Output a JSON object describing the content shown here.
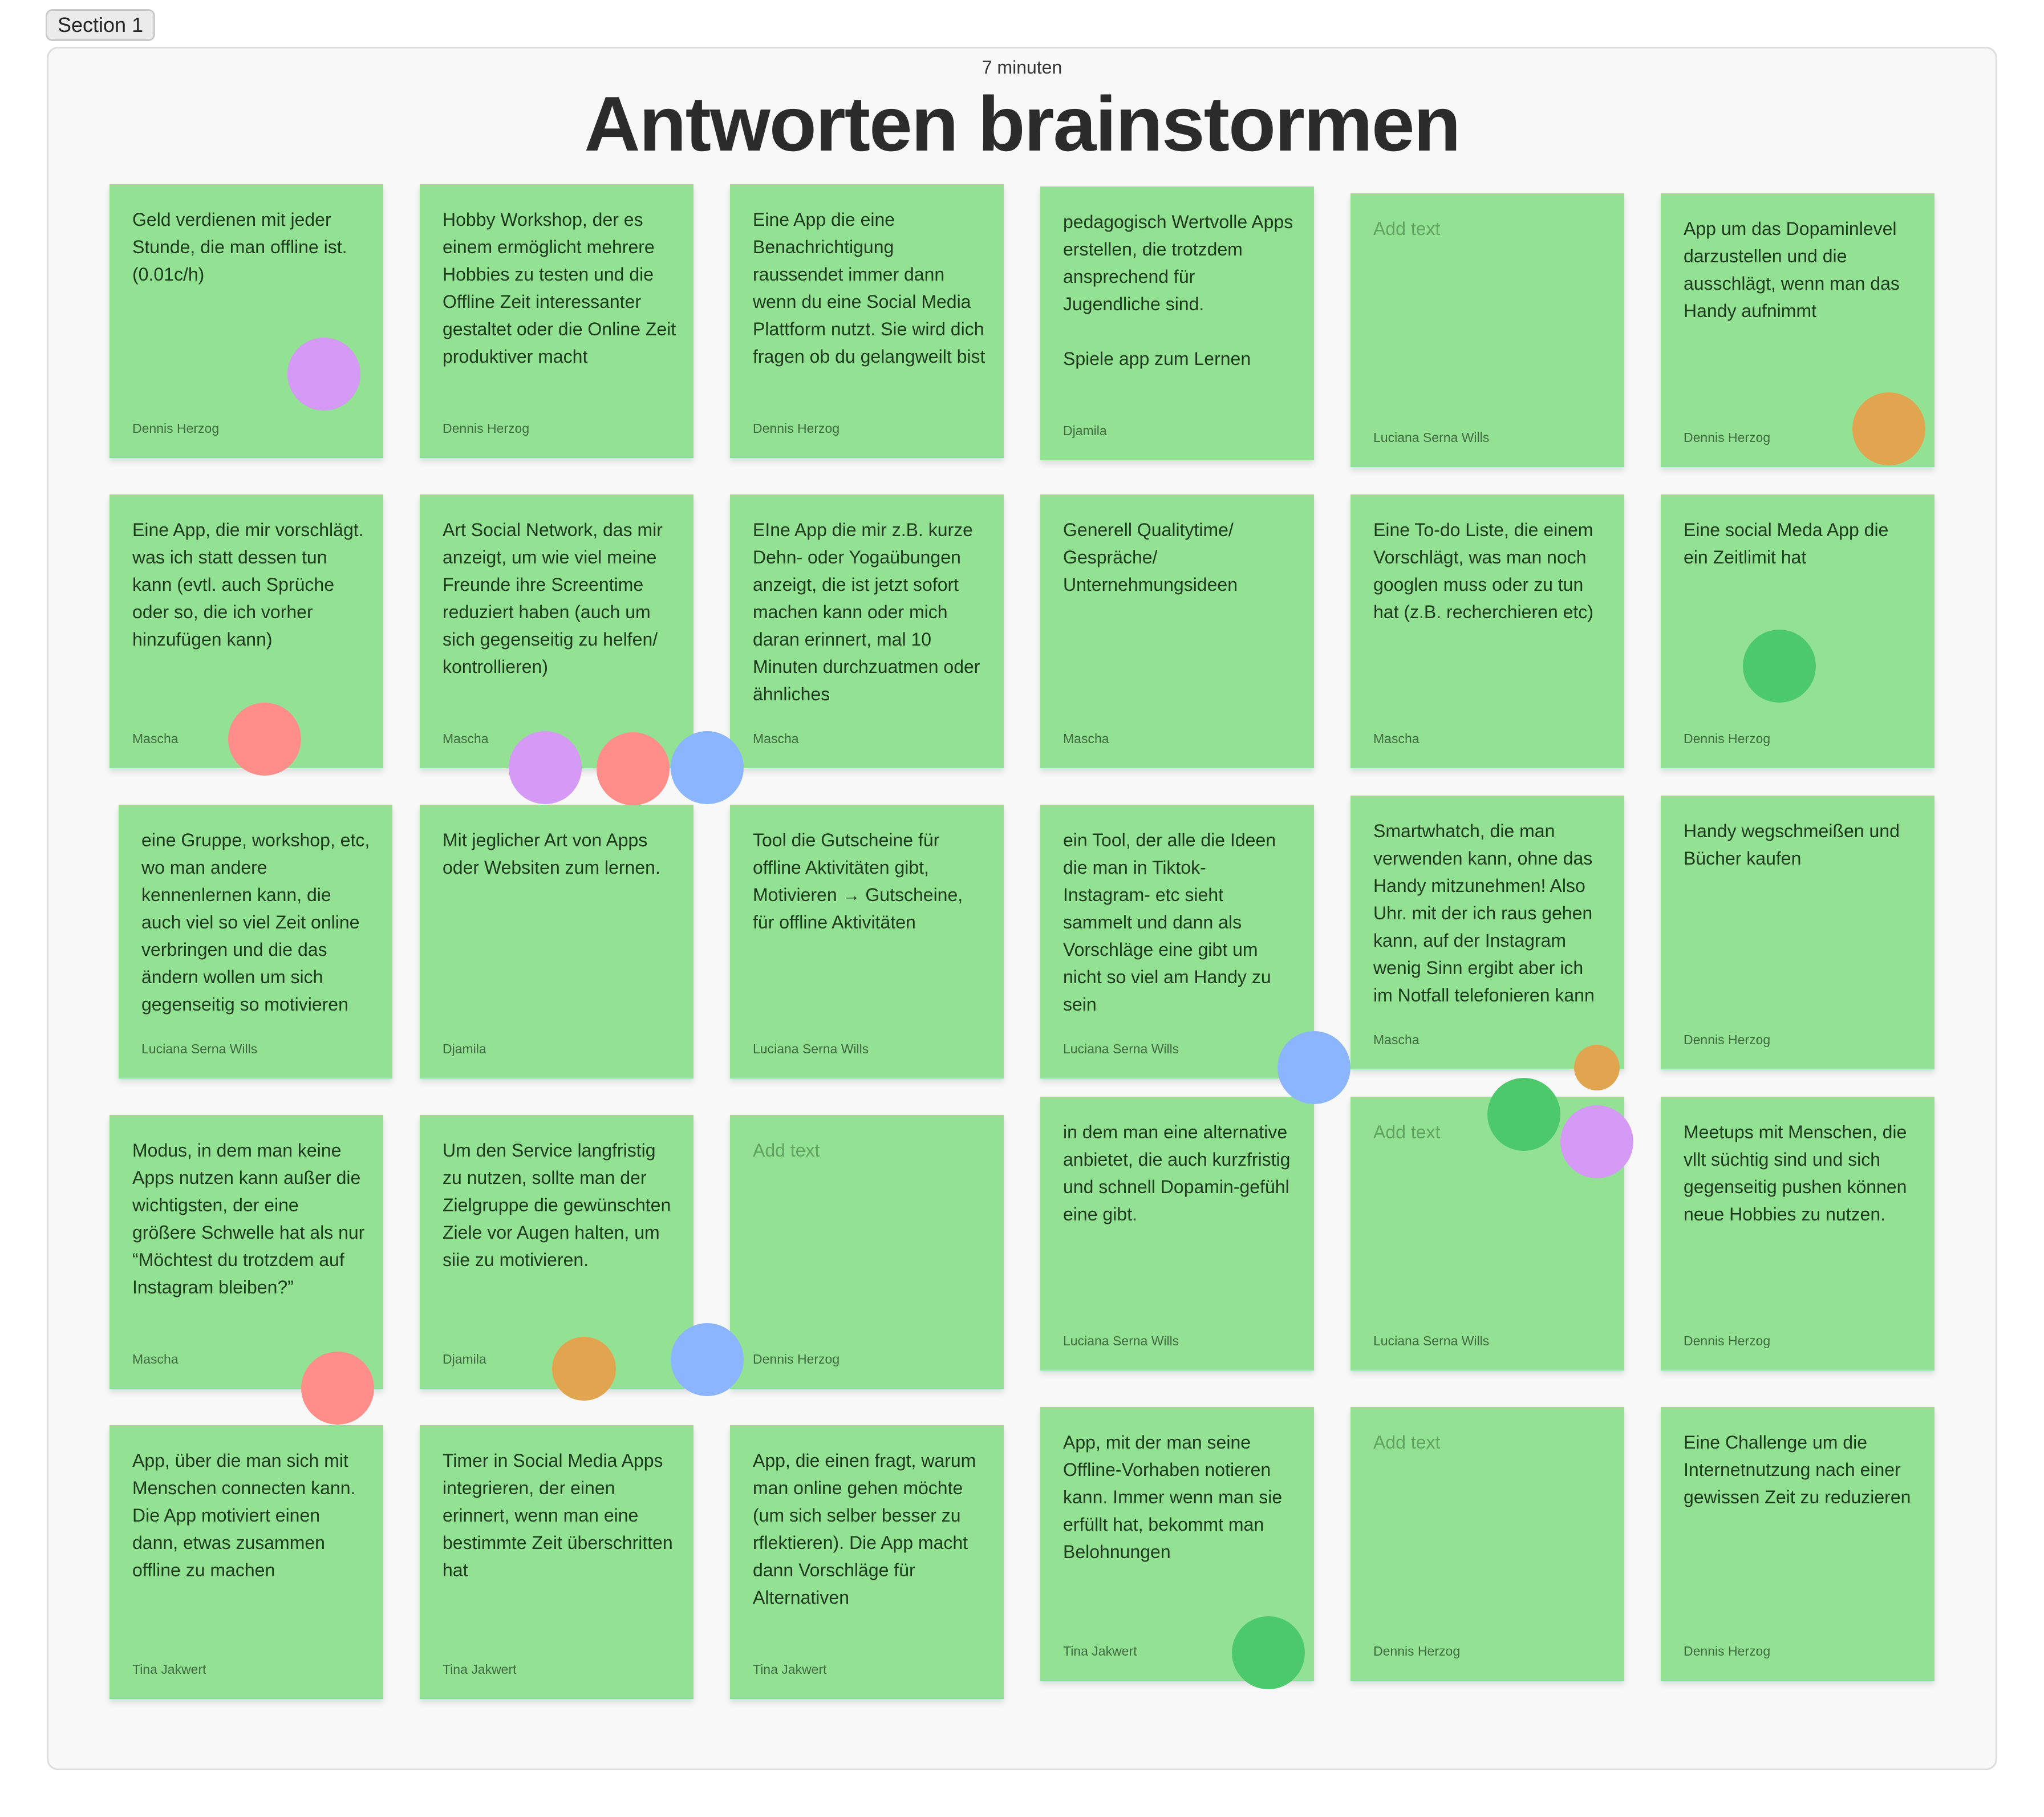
{
  "section": {
    "label": "Section 1"
  },
  "header": {
    "subtitle": "7 minuten",
    "title": "Antworten brainstormen"
  },
  "colors": {
    "sticky": "#93e293",
    "dot_purple": "#d49af5",
    "dot_orange": "#e2a54f",
    "dot_red": "#ff8e8a",
    "dot_blue": "#8bb6ff",
    "dot_green": "#4cc96b"
  },
  "notes": [
    {
      "text": "Geld verdienen mit jeder Stunde, die man offline ist. (0.01c/h)",
      "author": "Dennis Herzog"
    },
    {
      "text": "Hobby Workshop, der es einem ermöglicht mehrere Hobbies zu testen und die Offline Zeit interessanter gestaltet oder die Online Zeit produktiver macht",
      "author": "Dennis Herzog"
    },
    {
      "text": "Eine App die eine Benachrichtigung raussendet immer dann wenn du eine Social Media Plattform nutzt. Sie wird dich fragen ob du gelangweilt bist",
      "author": "Dennis Herzog"
    },
    {
      "text": "pedagogisch Wertvolle Apps erstellen, die trotzdem ansprechend für Jugendliche sind.\n\nSpiele app zum Lernen",
      "author": "Djamila"
    },
    {
      "text": "Add text",
      "author": "Luciana Serna Wills"
    },
    {
      "text": "App um das Dopaminlevel darzustellen und die ausschlägt, wenn man das Handy aufnimmt",
      "author": "Dennis Herzog"
    },
    {
      "text": "Eine App, die mir vorschlägt. was ich statt dessen tun kann (evtl. auch Sprüche oder so, die ich vorher hinzufügen kann)",
      "author": "Mascha"
    },
    {
      "text": "Art Social Network, das mir anzeigt, um wie viel meine Freunde ihre Screentime reduziert haben (auch um sich gegenseitig zu helfen/ kontrollieren)",
      "author": "Mascha"
    },
    {
      "text": "EIne App die mir z.B. kurze Dehn- oder Yogaübungen anzeigt, die ist jetzt sofort machen kann oder mich daran erinnert, mal 10 Minuten durchzuatmen oder ähnliches",
      "author": "Mascha"
    },
    {
      "text": "Generell Qualitytime/ Gespräche/ Unternehmungsideen",
      "author": "Mascha"
    },
    {
      "text": "Eine To-do Liste, die einem Vorschlägt, was man noch googlen muss oder zu tun hat (z.B. recherchieren etc)",
      "author": "Mascha"
    },
    {
      "text": "Eine social Meda App die ein Zeitlimit hat",
      "author": "Dennis Herzog"
    },
    {
      "text": "eine Gruppe, workshop, etc, wo man andere kennenlernen kann, die auch viel so viel Zeit online verbringen und die das ändern wollen um sich gegenseitig so motivieren",
      "author": "Luciana Serna Wills"
    },
    {
      "text": "Mit jeglicher Art von Apps oder Websiten zum lernen.",
      "author": "Djamila"
    },
    {
      "text": "Tool die Gutscheine für offline Aktivitäten gibt, Motivieren → Gutscheine, für offline Aktivitäten",
      "author": "Luciana Serna Wills"
    },
    {
      "text": "ein Tool, der alle die Ideen die man in Tiktok- Instagram- etc sieht sammelt und dann als Vorschläge eine gibt um nicht so viel am Handy zu sein",
      "author": "Luciana Serna Wills"
    },
    {
      "text": "Smartwhatch, die man verwenden kann, ohne das Handy mitzunehmen! Also Uhr. mit der ich raus gehen kann, auf der Instagram wenig Sinn ergibt aber ich im Notfall telefonieren kann",
      "author": "Mascha"
    },
    {
      "text": "Handy wegschmeißen und Bücher kaufen",
      "author": "Dennis Herzog"
    },
    {
      "text": "Modus, in dem man keine Apps nutzen kann außer die wichtigsten, der eine größere Schwelle hat als nur “Möchtest du trotzdem auf Instagram bleiben?”",
      "author": "Mascha"
    },
    {
      "text": "Um den Service langfristig zu nutzen, sollte man der Zielgruppe die gewünschten Ziele vor Augen halten, um siie zu motivieren.",
      "author": "Djamila"
    },
    {
      "text": "Add text",
      "author": "Dennis Herzog"
    },
    {
      "text": "in dem man eine alternative anbietet, die auch kurzfristig und schnell Dopamin-gefühl eine gibt.",
      "author": "Luciana Serna Wills"
    },
    {
      "text": "Add text",
      "author": "Luciana Serna Wills"
    },
    {
      "text": "Meetups mit Menschen, die vllt süchtig sind und sich gegenseitig pushen können neue Hobbies zu nutzen.",
      "author": "Dennis Herzog"
    },
    {
      "text": "App, über die man sich mit Menschen connecten kann. Die App motiviert einen dann, etwas zusammen offline zu machen",
      "author": "Tina Jakwert"
    },
    {
      "text": "Timer in Social Media Apps integrieren, der einen erinnert, wenn man eine bestimmte Zeit überschritten hat",
      "author": "Tina Jakwert"
    },
    {
      "text": "App, die einen fragt, warum man online gehen möchte (um sich selber besser zu rflektieren). Die App macht dann Vorschläge für Alternativen",
      "author": "Tina Jakwert"
    },
    {
      "text": "App, mit der man seine Offline-Vorhaben notieren kann. Immer wenn man sie erfüllt hat, bekommt man Belohnungen",
      "author": "Tina Jakwert"
    },
    {
      "text": "Add text",
      "author": "Dennis Herzog"
    },
    {
      "text": "Eine Challenge um die Internetnutzung nach einer gewissen Zeit zu reduzieren",
      "author": "Dennis Herzog"
    }
  ],
  "dots": [
    {
      "color": "purple"
    },
    {
      "color": "orange"
    },
    {
      "color": "red"
    },
    {
      "color": "purple"
    },
    {
      "color": "red"
    },
    {
      "color": "blue"
    },
    {
      "color": "green"
    },
    {
      "color": "blue"
    },
    {
      "color": "orange"
    },
    {
      "color": "green"
    },
    {
      "color": "purple"
    },
    {
      "color": "red"
    },
    {
      "color": "orange"
    },
    {
      "color": "blue"
    },
    {
      "color": "green"
    }
  ]
}
